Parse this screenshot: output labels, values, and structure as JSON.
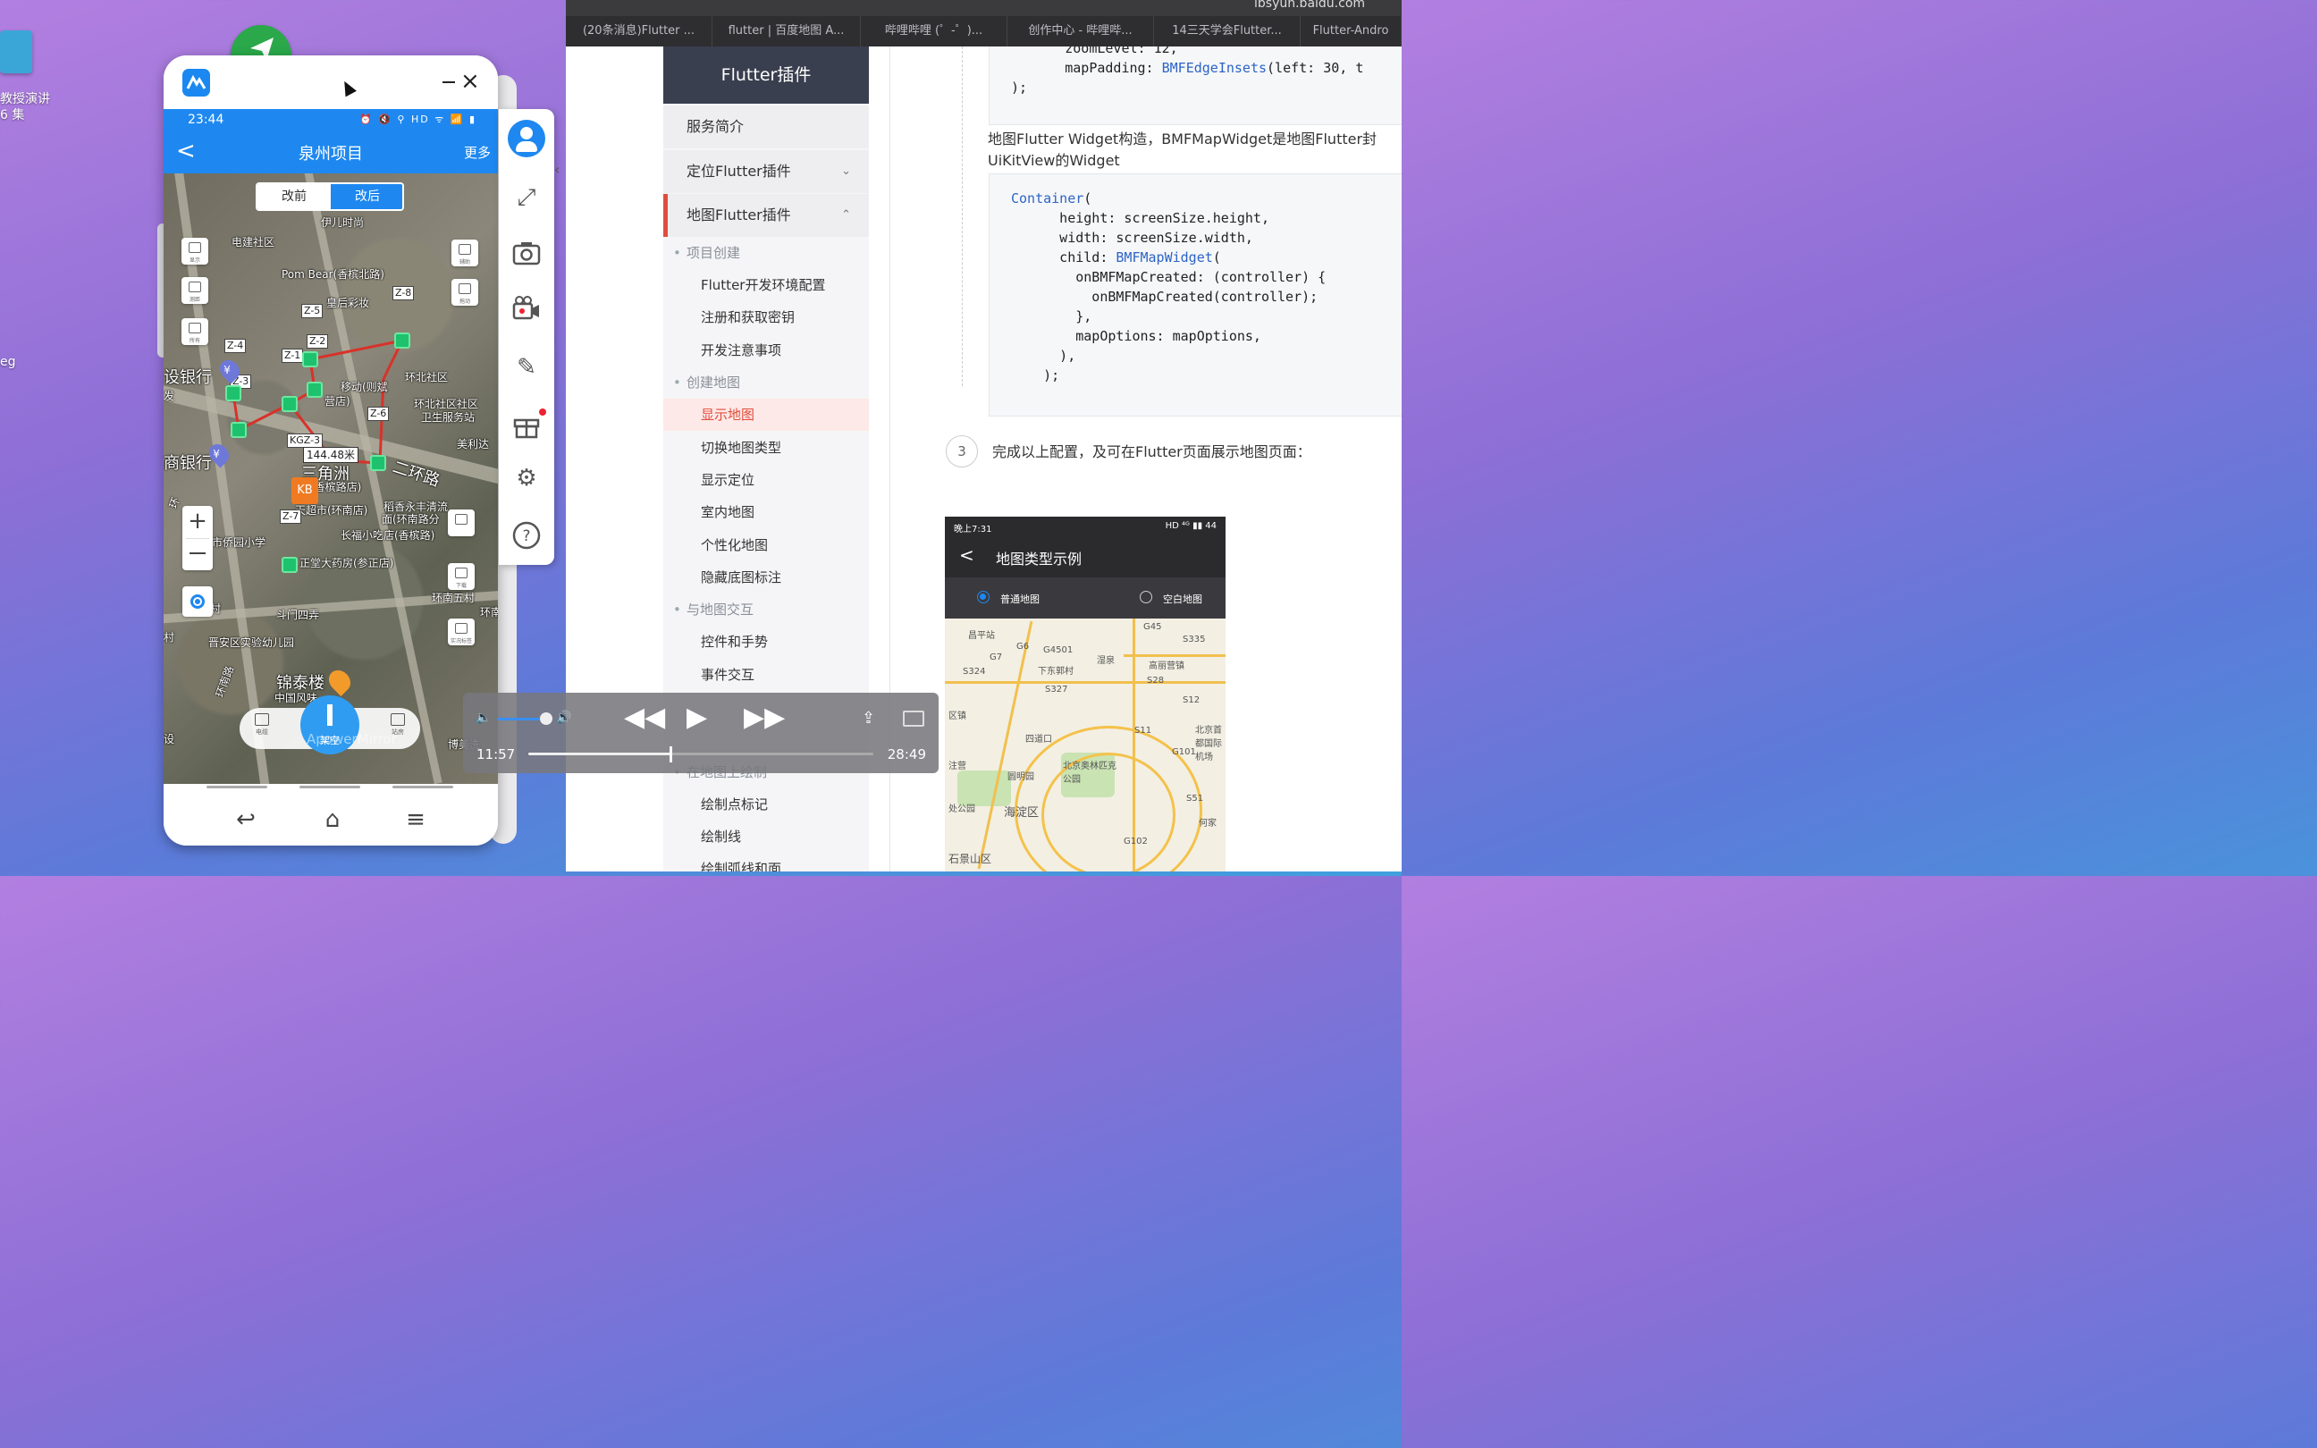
{
  "desktop": {
    "label_line1": "教授演讲",
    "label_line2": "6 集",
    "label_eg": "eg"
  },
  "mirror": {
    "app_name": "ApowerMirror",
    "watermark": "ApowerMirror",
    "status_time": "23:44",
    "status_icons": "⏰ 🔇 ⚲ HD ᯤ 📶 ▮",
    "appbar": {
      "back": "<",
      "title": "泉州项目",
      "more": "更多"
    },
    "segment": {
      "before": "改前",
      "after": "改后"
    },
    "map_buttons": {
      "left1": "显示",
      "left2": "测距",
      "left3": "所有",
      "right1": "辅助",
      "right2": "拖动",
      "right3": "下载",
      "right4": "实况标签"
    },
    "map_labels": [
      "伊儿时尚",
      "电建社区",
      "Pom Bear(香槟北路)",
      "皇后彩妆",
      "设银行",
      "发",
      "移动(则斌",
      "营店)",
      "环北社区",
      "环北社区社区",
      "卫生服务站",
      "美利达",
      "商银行",
      "二环路",
      "三角洲",
      "(香槟路店)",
      "天超市(环南店)",
      "稻香永丰清流",
      "面(环南路分",
      "长福小吃店(香槟路)",
      "福州市侨园小学",
      "正堂大药房(参正店)",
      "环南五村",
      "斗门四弄",
      "三村",
      "晋安区实验幼儿园",
      "环南路",
      "锦泰楼",
      "中国风味",
      "设",
      "博美洗",
      "村",
      "环",
      "环南"
    ],
    "zones": [
      "Z-8",
      "Z-5",
      "Z-2",
      "Z-4",
      "Z-1",
      "Z-3",
      "Z-6",
      "KGZ-3",
      "Z-7"
    ],
    "distance": "144.48米",
    "kb_label": "KB",
    "bottom_bar": {
      "left": "电缆",
      "center": "架空",
      "right": "站房"
    },
    "nav": {
      "back": "↩",
      "home": "⌂",
      "menu": "≡"
    }
  },
  "browser": {
    "url": "lbsyun.baidu.com",
    "tabs": [
      "(20条消息)Flutter ...",
      "flutter | 百度地图 A...",
      "哔哩哔哩 (゜-゜)...",
      "创作中心 - 哔哩哔...",
      "14三天学会Flutter...",
      "Flutter-Andro"
    ],
    "sidebar": {
      "title": "Flutter插件",
      "items": [
        {
          "label": "服务简介"
        },
        {
          "label": "定位Flutter插件",
          "chevron": "⌄"
        },
        {
          "label": "地图Flutter插件",
          "chevron": "⌃"
        }
      ],
      "groups": {
        "g1": "项目创建",
        "g1_items": [
          "Flutter开发环境配置",
          "注册和获取密钥",
          "开发注意事项"
        ],
        "g2": "创建地图",
        "g2_items": [
          "显示地图",
          "切换地图类型",
          "显示定位",
          "室内地图",
          "个性化地图",
          "隐藏底图标注"
        ],
        "g3": "与地图交互",
        "g3_items": [
          "控件和手势",
          "事件交互"
        ],
        "g4": "在地图上绘制",
        "g4_items": [
          "绘制点标记",
          "绘制线",
          "绘制弧线和面"
        ]
      }
    },
    "code_top": {
      "l1": "        zoomLevel: 12,",
      "l2": "        mapPadding: ",
      "l2b": "BMFEdgeInsets",
      "l2c": "(left: 30, t",
      "l3": ");"
    },
    "para": "地图Flutter Widget构造，BMFMapWidget是地图Flutter封装的UiKitView的Widget",
    "para_line1": "地图Flutter Widget构造，BMFMapWidget是地图Flutter封",
    "para_line2": "UiKitView的Widget",
    "code_main": {
      "l1a": "Container",
      "l1b": "(",
      "l2": "      height: screenSize.height,",
      "l3": "      width: screenSize.width,",
      "l4a": "      child: ",
      "l4b": "BMFMapWidget",
      "l4c": "(",
      "l5": "        onBMFMapCreated: (controller) {",
      "l6": "          onBMFMapCreated(controller);",
      "l7": "        },",
      "l8": "        mapOptions: mapOptions,",
      "l9": "      ),",
      "l10": "    );"
    },
    "step_number": "3",
    "step_text": "完成以上配置，及可在Flutter页面展示地图页面：",
    "sample": {
      "time": "晚上7:31",
      "status_icons": "HD ⁴ᴳ ▮▮ 44",
      "back": "<",
      "title": "地图类型示例",
      "radio1": "普通地图",
      "radio2": "空白地图",
      "labels": [
        "昌平站",
        "下东郭村",
        "湿泉",
        "高丽营镇",
        "北京首都国际机场",
        "圆明园",
        "北京奥林匹克公园",
        "海淀区",
        "石景山区",
        "注营",
        "处公园",
        "何家",
        "G45",
        "G6",
        "G4501",
        "S324",
        "S327",
        "G102",
        "S51",
        "S11",
        "G101",
        "G7",
        "S28",
        "S335",
        "S12",
        "四道口",
        "区镇"
      ]
    }
  },
  "player": {
    "current": "11:57",
    "total": "28:49",
    "progress": 0.413,
    "volume": 0.75
  }
}
